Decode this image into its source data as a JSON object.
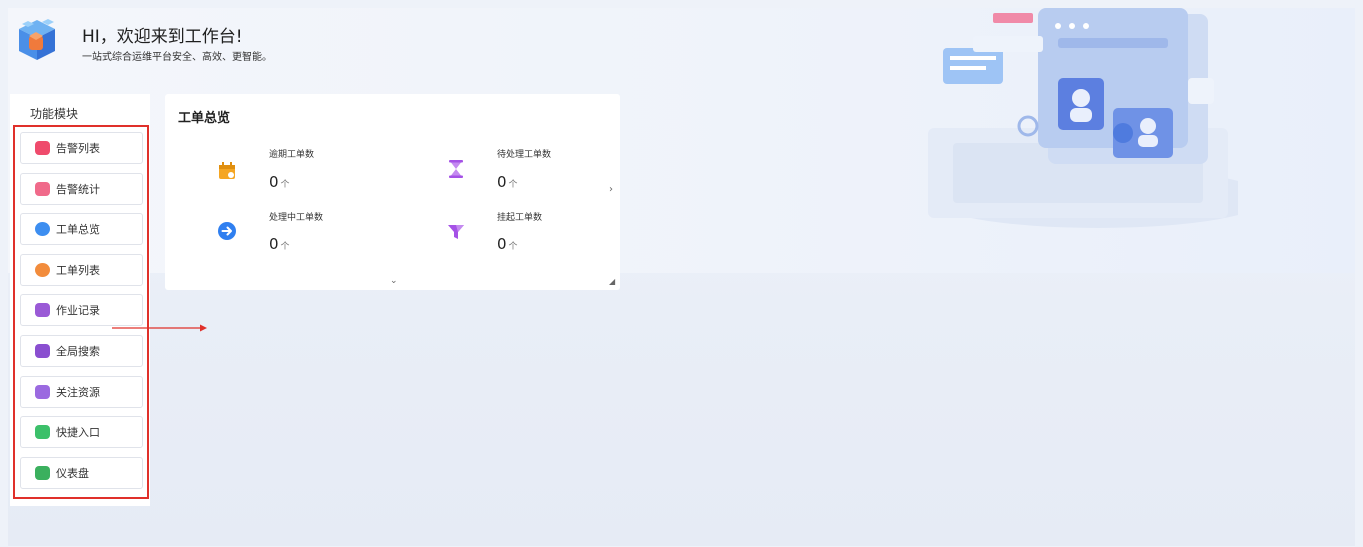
{
  "header": {
    "greeting": "HI，欢迎来到工作台!",
    "subtitle": "一站式综合运维平台安全、高效、更智能。"
  },
  "modules": {
    "title": "功能模块",
    "items": [
      {
        "label": "告警列表",
        "icon": "alert-list-icon",
        "color": "#ef4b6c"
      },
      {
        "label": "告警统计",
        "icon": "alert-stats-icon",
        "color": "#f06a8a"
      },
      {
        "label": "工单总览",
        "icon": "ticket-overview-icon",
        "color": "#3d8ef0"
      },
      {
        "label": "工单列表",
        "icon": "ticket-list-icon",
        "color": "#f28c3c"
      },
      {
        "label": "作业记录",
        "icon": "job-record-icon",
        "color": "#9a5ad6"
      },
      {
        "label": "全局搜索",
        "icon": "global-search-icon",
        "color": "#8a4fd0"
      },
      {
        "label": "关注资源",
        "icon": "followed-resources-icon",
        "color": "#9b6ae0"
      },
      {
        "label": "快捷入口",
        "icon": "shortcut-icon",
        "color": "#3cc06a"
      },
      {
        "label": "仪表盘",
        "icon": "dashboard-icon",
        "color": "#3bb05e"
      }
    ]
  },
  "overview": {
    "title": "工单总览",
    "unit": "个",
    "stats": [
      {
        "label": "逾期工单数",
        "value": "0",
        "icon": "calendar-icon",
        "color": "#f5a623"
      },
      {
        "label": "待处理工单数",
        "value": "0",
        "icon": "hourglass-icon",
        "color": "#a552e6"
      },
      {
        "label": "处理中工单数",
        "value": "0",
        "icon": "arrow-circle-icon",
        "color": "#2f7ff0"
      },
      {
        "label": "挂起工单数",
        "value": "0",
        "icon": "funnel-icon",
        "color": "#a552e6"
      }
    ]
  },
  "colors": {
    "highlight": "#e0302a",
    "background": "#eef2f9"
  }
}
